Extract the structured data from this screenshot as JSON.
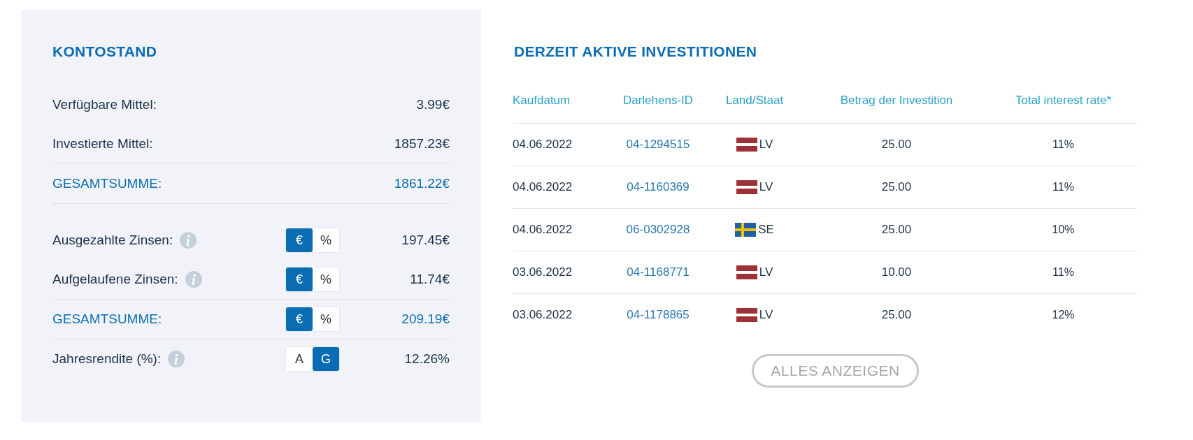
{
  "balance": {
    "title": "KONTOSTAND",
    "rows": [
      {
        "kind": "plain",
        "label": "Verfügbare Mittel:",
        "value": "3.99€"
      },
      {
        "kind": "plain",
        "label": "Investierte Mittel:",
        "value": "1857.23€"
      },
      {
        "kind": "total",
        "label": "GESAMTSUMME:",
        "value": "1861.22€"
      }
    ],
    "interest_rows": [
      {
        "kind": "plain",
        "label": "Ausgezahlte Zinsen:",
        "info": true,
        "toggle": [
          {
            "label": "€",
            "selected": true
          },
          {
            "label": "%",
            "selected": false
          }
        ],
        "value": "197.45€"
      },
      {
        "kind": "plain",
        "label": "Aufgelaufene Zinsen:",
        "info": true,
        "toggle": [
          {
            "label": "€",
            "selected": true
          },
          {
            "label": "%",
            "selected": false
          }
        ],
        "value": "11.74€"
      },
      {
        "kind": "total",
        "label": "GESAMTSUMME:",
        "info": false,
        "toggle": [
          {
            "label": "€",
            "selected": true
          },
          {
            "label": "%",
            "selected": false
          }
        ],
        "value": "209.19€"
      },
      {
        "kind": "plain",
        "label": "Jahresrendite (%):",
        "info": true,
        "toggle": [
          {
            "label": "A",
            "selected": false
          },
          {
            "label": "G",
            "selected": true
          }
        ],
        "value": "12.26%"
      }
    ]
  },
  "investments": {
    "title": "DERZEIT AKTIVE INVESTITIONEN",
    "columns": [
      "Kaufdatum",
      "Darlehens-ID",
      "Land/Staat",
      "Betrag der Investition",
      "Total interest rate*"
    ],
    "rows": [
      {
        "date": "04.06.2022",
        "loan_id": "04-1294515",
        "kind": "latvia",
        "country": "LV",
        "amount": "25.00",
        "rate": "11%"
      },
      {
        "date": "04.06.2022",
        "loan_id": "04-1160369",
        "kind": "latvia",
        "country": "LV",
        "amount": "25.00",
        "rate": "11%"
      },
      {
        "date": "04.06.2022",
        "loan_id": "06-0302928",
        "kind": "sweden",
        "country": "SE",
        "amount": "25.00",
        "rate": "10%"
      },
      {
        "date": "03.06.2022",
        "loan_id": "04-1168771",
        "kind": "latvia",
        "country": "LV",
        "amount": "10.00",
        "rate": "11%"
      },
      {
        "date": "03.06.2022",
        "loan_id": "04-1178865",
        "kind": "latvia",
        "country": "LV",
        "amount": "25.00",
        "rate": "12%"
      }
    ],
    "show_all": "ALLES ANZEIGEN"
  }
}
